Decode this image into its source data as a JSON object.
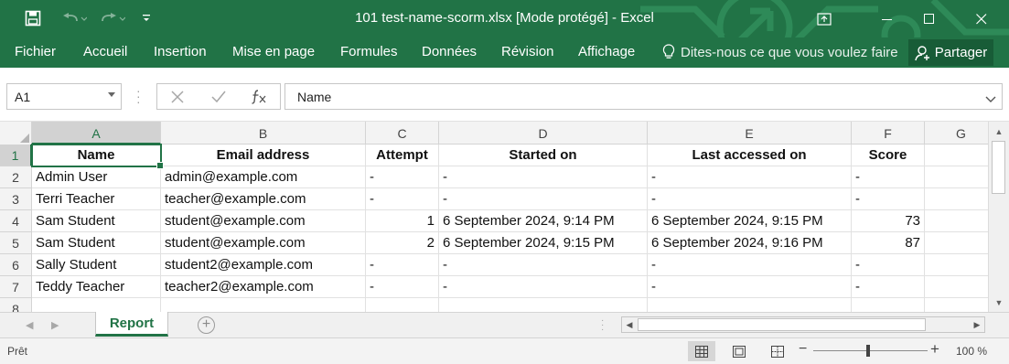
{
  "window": {
    "title": "101 test-name-scorm.xlsx  [Mode protégé] - Excel"
  },
  "ribbon": {
    "tabs": [
      "Fichier",
      "Accueil",
      "Insertion",
      "Mise en page",
      "Formules",
      "Données",
      "Révision",
      "Affichage"
    ],
    "tell_me": "Dites-nous ce que vous voulez faire",
    "share": "Partager"
  },
  "formula_bar": {
    "name_box": "A1",
    "formula": "Name"
  },
  "grid": {
    "columns": [
      "A",
      "B",
      "C",
      "D",
      "E",
      "F",
      "G"
    ],
    "rows": [
      "1",
      "2",
      "3",
      "4",
      "5",
      "6",
      "7",
      "8"
    ],
    "header": [
      "Name",
      "Email address",
      "Attempt",
      "Started on",
      "Last accessed on",
      "Score"
    ],
    "data": [
      [
        "Admin User",
        "admin@example.com",
        "-",
        "-",
        "-",
        "-"
      ],
      [
        "Terri Teacher",
        "teacher@example.com",
        "-",
        "-",
        "-",
        "-"
      ],
      [
        "Sam Student",
        "student@example.com",
        "1",
        "6 September 2024, 9:14 PM",
        "6 September 2024, 9:15 PM",
        "73"
      ],
      [
        "Sam Student",
        "student@example.com",
        "2",
        "6 September 2024, 9:15 PM",
        "6 September 2024, 9:16 PM",
        "87"
      ],
      [
        "Sally Student",
        "student2@example.com",
        "-",
        "-",
        "-",
        "-"
      ],
      [
        "Teddy Teacher",
        "teacher2@example.com",
        "-",
        "-",
        "-",
        "-"
      ]
    ]
  },
  "sheets": {
    "active": "Report"
  },
  "status": {
    "text": "Prêt",
    "zoom": "100 %"
  },
  "colors": {
    "accent": "#217346",
    "accent_dark": "#185c37"
  }
}
